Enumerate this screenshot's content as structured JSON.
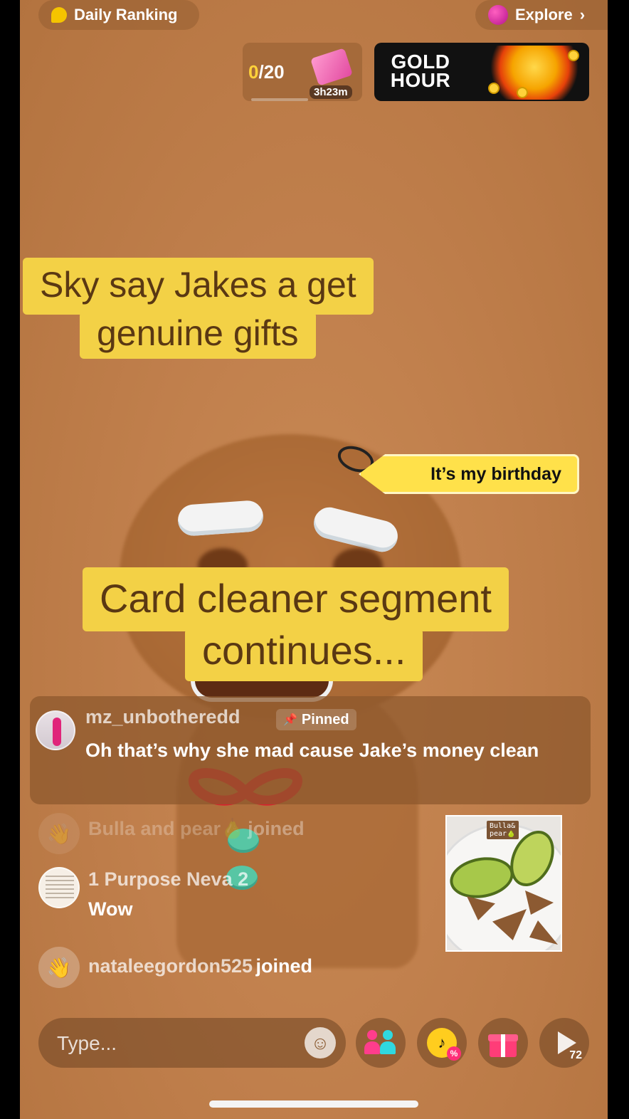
{
  "top_bar": {
    "ranking_label": "Daily Ranking",
    "explore_label": "Explore",
    "explore_chevron": "›"
  },
  "quest": {
    "done": "0",
    "total": "/20",
    "timer": "3h23m",
    "progress_fraction": 0.0
  },
  "gold_hour": {
    "line1": "GOLD",
    "line2": "HOUR"
  },
  "captions": {
    "line1a": "Sky say Jakes a get",
    "line1b": "genuine gifts",
    "line2a": "Card cleaner segment",
    "line2b": "continues..."
  },
  "birthday_tag": "It’s my birthday",
  "pinned_comment": {
    "username": "mz_unbotheredd",
    "badge": "Pinned",
    "text": "Oh that’s why she mad cause Jake’s money clean"
  },
  "chat": {
    "joined_faded": {
      "username": "Bulla and pear🍐",
      "action": "joined"
    },
    "comment": {
      "username": "1 Purpose Neva 2",
      "message": "Wow"
    },
    "joined_recent": {
      "username": "nataleegordon525",
      "action": "joined"
    }
  },
  "shared_photo": {
    "label": "Bulla&\npear🍐"
  },
  "bottom_bar": {
    "input_placeholder": "Type...",
    "share_count": "72"
  },
  "colors": {
    "caption_bg": "#f3d146",
    "caption_text": "#5a3813",
    "accent_yellow": "#ffd23a",
    "tag_bg": "#ffe14a"
  },
  "icons": [
    "lemon-icon",
    "planet-icon",
    "gift-box-icon",
    "pin-icon",
    "wave-icon",
    "emoji-icon",
    "guests-icon",
    "promo-icon",
    "gift-icon",
    "share-icon"
  ]
}
